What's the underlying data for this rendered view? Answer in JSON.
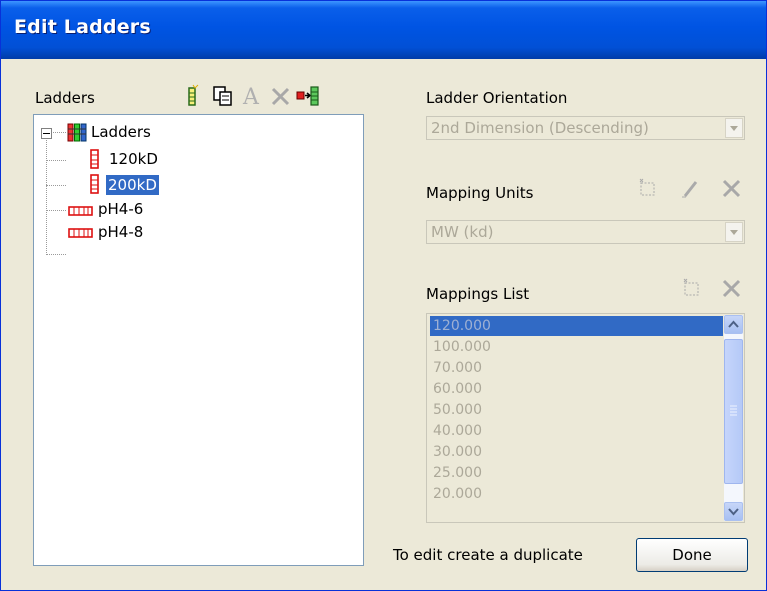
{
  "window": {
    "title": "Edit Ladders"
  },
  "ladders": {
    "label": "Ladders",
    "toolbar": {
      "add": "ladder-add-icon",
      "copy": "copy-icon",
      "rename": "rename-icon",
      "delete": "delete-icon",
      "export": "ladder-export-icon"
    },
    "tree": {
      "root": "Ladders",
      "items": [
        {
          "label": "120kD",
          "icon": "vertical-ladder-icon"
        },
        {
          "label": "200kD",
          "icon": "vertical-ladder-icon",
          "selected": true
        },
        {
          "label": "pH4-6",
          "icon": "horizontal-ladder-icon"
        },
        {
          "label": "pH4-8",
          "icon": "horizontal-ladder-icon"
        }
      ]
    }
  },
  "orientation": {
    "label": "Ladder Orientation",
    "value": "2nd Dimension (Descending)"
  },
  "units": {
    "label": "Mapping Units",
    "value": "MW (kd)"
  },
  "mappings": {
    "label": "Mappings List",
    "items": [
      "120.000",
      "100.000",
      "70.000",
      "60.000",
      "50.000",
      "40.000",
      "30.000",
      "25.000",
      "20.000"
    ],
    "selected_index": 0
  },
  "footer": {
    "hint": "To edit create a duplicate",
    "done_label": "Done"
  },
  "colors": {
    "title_bar": "#0054e3",
    "selection": "#316ac5",
    "disabled_text": "#aca899"
  }
}
